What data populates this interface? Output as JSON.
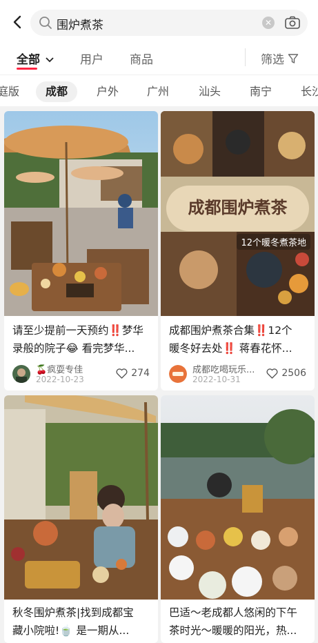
{
  "search": {
    "query": "围炉煮茶"
  },
  "tabs": [
    {
      "label": "全部"
    },
    {
      "label": "用户"
    },
    {
      "label": "商品"
    }
  ],
  "filter_label": "筛选",
  "chips": [
    "庭版",
    "成都",
    "户外",
    "广州",
    "汕头",
    "南宁",
    "长沙"
  ],
  "cards": [
    {
      "title_a": "请至少提前一天预约",
      "title_b": "梦华",
      "title_c": "录般的院子",
      "title_d": "看完梦华...",
      "author": "疯耍专佳",
      "date": "2022-10-23",
      "likes": "274"
    },
    {
      "overlay_title": "成都围炉煮茶",
      "overlay_sub": "12个暖冬煮茶地",
      "title_a": "成都围炉煮茶合集",
      "title_b": "12个",
      "title_c": "暖冬好去处",
      "title_d": "蒋春花怀...",
      "author": "成都吃喝玩乐...",
      "date": "2022-10-31",
      "likes": "2506"
    },
    {
      "title_a": "秋冬围炉煮茶|找到成都宝",
      "title_b": "藏小院啦!",
      "title_c": "是一期从..."
    },
    {
      "title_a": "巴适～老成都人悠闲的下午",
      "title_b": "茶时光～暖暖的阳光，热..."
    }
  ]
}
